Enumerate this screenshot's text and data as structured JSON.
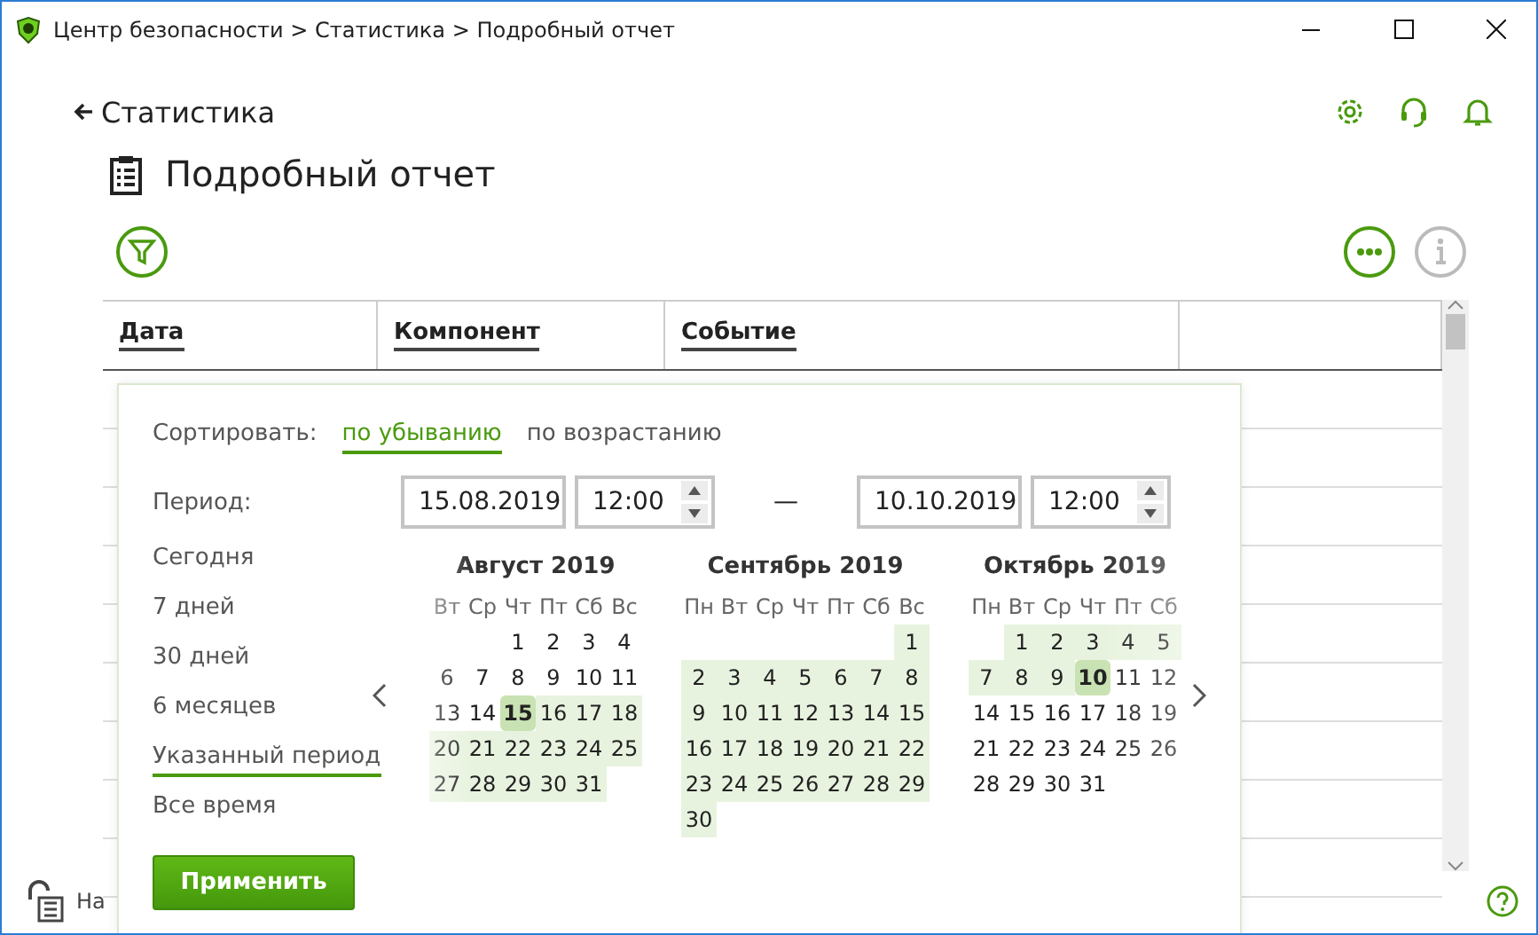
{
  "window": {
    "title": "Центр безопасности > Статистика > Подробный отчет"
  },
  "header": {
    "back_link": "Статистика",
    "page_title": "Подробный отчет"
  },
  "table": {
    "columns": [
      "Дата",
      "Компонент",
      "Событие"
    ]
  },
  "filter_popup": {
    "sort_label": "Сортировать:",
    "sort_options": [
      {
        "label": "по убыванию",
        "selected": true
      },
      {
        "label": "по возрастанию",
        "selected": false
      }
    ],
    "period_label": "Период:",
    "periods": [
      {
        "label": "Сегодня",
        "selected": false
      },
      {
        "label": "7 дней",
        "selected": false
      },
      {
        "label": "30 дней",
        "selected": false
      },
      {
        "label": "6 месяцев",
        "selected": false
      },
      {
        "label": "Указанный период",
        "selected": true
      },
      {
        "label": "Все время",
        "selected": false
      }
    ],
    "start": {
      "date": "15.08.2019",
      "time": "12:00"
    },
    "range_separator": "—",
    "end": {
      "date": "10.10.2019",
      "time": "12:00"
    },
    "months": [
      {
        "title": "Август 2019",
        "weekdays": [
          "Вт",
          "Ср",
          "Чт",
          "Пт",
          "Сб",
          "Вс"
        ],
        "weeks": [
          [
            {
              "day": "1",
              "in_range": false,
              "selected": false
            },
            {
              "day": "2",
              "in_range": false,
              "selected": false
            },
            {
              "day": "3",
              "in_range": false,
              "selected": false
            },
            {
              "day": "4",
              "in_range": false,
              "selected": false
            }
          ],
          [
            {
              "day": "6",
              "in_range": false,
              "selected": false
            },
            {
              "day": "7",
              "in_range": false,
              "selected": false
            },
            {
              "day": "8",
              "in_range": false,
              "selected": false
            },
            {
              "day": "9",
              "in_range": false,
              "selected": false
            },
            {
              "day": "10",
              "in_range": false,
              "selected": false
            },
            {
              "day": "11",
              "in_range": false,
              "selected": false
            }
          ],
          [
            {
              "day": "13",
              "in_range": false,
              "selected": false
            },
            {
              "day": "14",
              "in_range": false,
              "selected": false
            },
            {
              "day": "15",
              "in_range": true,
              "selected": true
            },
            {
              "day": "16",
              "in_range": true,
              "selected": false
            },
            {
              "day": "17",
              "in_range": true,
              "selected": false
            },
            {
              "day": "18",
              "in_range": true,
              "selected": false
            }
          ],
          [
            {
              "day": "20",
              "in_range": true,
              "selected": false
            },
            {
              "day": "21",
              "in_range": true,
              "selected": false
            },
            {
              "day": "22",
              "in_range": true,
              "selected": false
            },
            {
              "day": "23",
              "in_range": true,
              "selected": false
            },
            {
              "day": "24",
              "in_range": true,
              "selected": false
            },
            {
              "day": "25",
              "in_range": true,
              "selected": false
            }
          ],
          [
            {
              "day": "27",
              "in_range": true,
              "selected": false
            },
            {
              "day": "28",
              "in_range": true,
              "selected": false
            },
            {
              "day": "29",
              "in_range": true,
              "selected": false
            },
            {
              "day": "30",
              "in_range": true,
              "selected": false
            },
            {
              "day": "31",
              "in_range": true,
              "selected": false
            }
          ]
        ]
      },
      {
        "title": "Сентябрь 2019",
        "weekdays": [
          "Пн",
          "Вт",
          "Ср",
          "Чт",
          "Пт",
          "Сб",
          "Вс"
        ],
        "weeks": [
          [
            {
              "day": "1",
              "in_range": true,
              "selected": false
            }
          ],
          [
            {
              "day": "2",
              "in_range": true,
              "selected": false
            },
            {
              "day": "3",
              "in_range": true,
              "selected": false
            },
            {
              "day": "4",
              "in_range": true,
              "selected": false
            },
            {
              "day": "5",
              "in_range": true,
              "selected": false
            },
            {
              "day": "6",
              "in_range": true,
              "selected": false
            },
            {
              "day": "7",
              "in_range": true,
              "selected": false
            },
            {
              "day": "8",
              "in_range": true,
              "selected": false
            }
          ],
          [
            {
              "day": "9",
              "in_range": true,
              "selected": false
            },
            {
              "day": "10",
              "in_range": true,
              "selected": false
            },
            {
              "day": "11",
              "in_range": true,
              "selected": false
            },
            {
              "day": "12",
              "in_range": true,
              "selected": false
            },
            {
              "day": "13",
              "in_range": true,
              "selected": false
            },
            {
              "day": "14",
              "in_range": true,
              "selected": false
            },
            {
              "day": "15",
              "in_range": true,
              "selected": false
            }
          ],
          [
            {
              "day": "16",
              "in_range": true,
              "selected": false
            },
            {
              "day": "17",
              "in_range": true,
              "selected": false
            },
            {
              "day": "18",
              "in_range": true,
              "selected": false
            },
            {
              "day": "19",
              "in_range": true,
              "selected": false
            },
            {
              "day": "20",
              "in_range": true,
              "selected": false
            },
            {
              "day": "21",
              "in_range": true,
              "selected": false
            },
            {
              "day": "22",
              "in_range": true,
              "selected": false
            }
          ],
          [
            {
              "day": "23",
              "in_range": true,
              "selected": false
            },
            {
              "day": "24",
              "in_range": true,
              "selected": false
            },
            {
              "day": "25",
              "in_range": true,
              "selected": false
            },
            {
              "day": "26",
              "in_range": true,
              "selected": false
            },
            {
              "day": "27",
              "in_range": true,
              "selected": false
            },
            {
              "day": "28",
              "in_range": true,
              "selected": false
            },
            {
              "day": "29",
              "in_range": true,
              "selected": false
            }
          ],
          [
            {
              "day": "30",
              "in_range": true,
              "selected": false
            }
          ]
        ]
      },
      {
        "title": "Октябрь 2019",
        "weekdays": [
          "Пн",
          "Вт",
          "Ср",
          "Чт",
          "Пт",
          "Сб"
        ],
        "weeks": [
          [
            {
              "day": "1",
              "in_range": true,
              "selected": false
            },
            {
              "day": "2",
              "in_range": true,
              "selected": false
            },
            {
              "day": "3",
              "in_range": true,
              "selected": false
            },
            {
              "day": "4",
              "in_range": true,
              "selected": false
            },
            {
              "day": "5",
              "in_range": true,
              "selected": false
            }
          ],
          [
            {
              "day": "7",
              "in_range": true,
              "selected": false
            },
            {
              "day": "8",
              "in_range": true,
              "selected": false
            },
            {
              "day": "9",
              "in_range": true,
              "selected": false
            },
            {
              "day": "10",
              "in_range": true,
              "selected": true
            },
            {
              "day": "11",
              "in_range": false,
              "selected": false
            },
            {
              "day": "12",
              "in_range": false,
              "selected": false
            }
          ],
          [
            {
              "day": "14",
              "in_range": false,
              "selected": false
            },
            {
              "day": "15",
              "in_range": false,
              "selected": false
            },
            {
              "day": "16",
              "in_range": false,
              "selected": false
            },
            {
              "day": "17",
              "in_range": false,
              "selected": false
            },
            {
              "day": "18",
              "in_range": false,
              "selected": false
            },
            {
              "day": "19",
              "in_range": false,
              "selected": false
            }
          ],
          [
            {
              "day": "21",
              "in_range": false,
              "selected": false
            },
            {
              "day": "22",
              "in_range": false,
              "selected": false
            },
            {
              "day": "23",
              "in_range": false,
              "selected": false
            },
            {
              "day": "24",
              "in_range": false,
              "selected": false
            },
            {
              "day": "25",
              "in_range": false,
              "selected": false
            },
            {
              "day": "26",
              "in_range": false,
              "selected": false
            }
          ],
          [
            {
              "day": "28",
              "in_range": false,
              "selected": false
            },
            {
              "day": "29",
              "in_range": false,
              "selected": false
            },
            {
              "day": "30",
              "in_range": false,
              "selected": false
            },
            {
              "day": "31",
              "in_range": false,
              "selected": false
            }
          ]
        ]
      }
    ],
    "apply_button": "Применить"
  },
  "status_bar": {
    "text": "На"
  }
}
